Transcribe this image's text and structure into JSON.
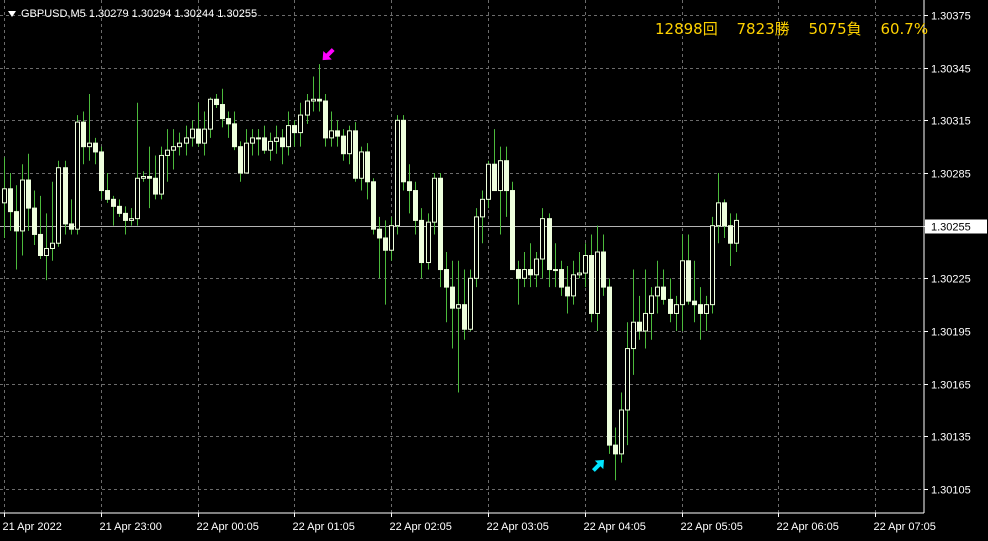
{
  "symbol_info": "GBPUSD,M5  1.30279 1.30294 1.30244 1.30255",
  "stats": {
    "total": "12898回",
    "wins": "7823勝",
    "losses": "5075負",
    "rate": "60.7%"
  },
  "colors": {
    "background": "#000000",
    "grid": "#6b6b6b",
    "candle_body": "#eeffdd",
    "wick": "#4cbb3c",
    "axis_text": "#ffffff",
    "price_line": "#b4b4b4",
    "sell_arrow": "#ff00ff",
    "buy_arrow": "#00e5ff",
    "stats_text": "#ffd200"
  },
  "chart_data": {
    "type": "candlestick",
    "symbol": "GBPUSD",
    "timeframe": "M5",
    "ylim": [
      1.30085,
      1.30385
    ],
    "y_ticks": [
      "1.30375",
      "1.30345",
      "1.30315",
      "1.30285",
      "1.30255",
      "1.30225",
      "1.30195",
      "1.30165",
      "1.30135",
      "1.30105"
    ],
    "current_price": "1.30255",
    "x_tick_labels": [
      "21 Apr 2022",
      "21 Apr 23:00",
      "22 Apr 00:05",
      "22 Apr 01:05",
      "22 Apr 02:05",
      "22 Apr 03:05",
      "22 Apr 04:05",
      "22 Apr 05:05",
      "22 Apr 06:05",
      "22 Apr 07:05"
    ],
    "x_tick_bars": [
      0,
      16,
      32,
      48,
      64,
      80,
      96,
      112,
      128,
      144
    ],
    "candles": [
      [
        1.30268,
        1.30294,
        1.30248,
        1.30276
      ],
      [
        1.30276,
        1.30285,
        1.30252,
        1.30263
      ],
      [
        1.30263,
        1.30278,
        1.3023,
        1.30252
      ],
      [
        1.30252,
        1.3029,
        1.30238,
        1.30281
      ],
      [
        1.30281,
        1.30296,
        1.30252,
        1.30265
      ],
      [
        1.30265,
        1.30275,
        1.30244,
        1.3025
      ],
      [
        1.3025,
        1.30272,
        1.30236,
        1.30238
      ],
      [
        1.30238,
        1.30262,
        1.30224,
        1.30242
      ],
      [
        1.30242,
        1.3028,
        1.30235,
        1.30245
      ],
      [
        1.30245,
        1.30292,
        1.30243,
        1.30288
      ],
      [
        1.30288,
        1.30292,
        1.3025,
        1.30256
      ],
      [
        1.30256,
        1.3027,
        1.3025,
        1.30253
      ],
      [
        1.30253,
        1.30318,
        1.3025,
        1.30314
      ],
      [
        1.30314,
        1.3032,
        1.3029,
        1.303
      ],
      [
        1.303,
        1.3033,
        1.30292,
        1.30302
      ],
      [
        1.30302,
        1.30305,
        1.3029,
        1.30297
      ],
      [
        1.30297,
        1.303,
        1.3027,
        1.30275
      ],
      [
        1.30275,
        1.30285,
        1.30268,
        1.3027
      ],
      [
        1.3027,
        1.30272,
        1.30255,
        1.30266
      ],
      [
        1.30266,
        1.3027,
        1.3026,
        1.30262
      ],
      [
        1.30262,
        1.30266,
        1.3025,
        1.30258
      ],
      [
        1.30258,
        1.30265,
        1.30255,
        1.30259
      ],
      [
        1.30259,
        1.30325,
        1.30255,
        1.30282
      ],
      [
        1.30282,
        1.30286,
        1.3028,
        1.30283
      ],
      [
        1.30283,
        1.303,
        1.30265,
        1.30282
      ],
      [
        1.30282,
        1.30295,
        1.3027,
        1.30273
      ],
      [
        1.30273,
        1.303,
        1.3027,
        1.30295
      ],
      [
        1.30295,
        1.3031,
        1.3028,
        1.30298
      ],
      [
        1.30298,
        1.3031,
        1.30287,
        1.303
      ],
      [
        1.303,
        1.30308,
        1.30295,
        1.30302
      ],
      [
        1.30302,
        1.30312,
        1.30295,
        1.30305
      ],
      [
        1.30305,
        1.30315,
        1.303,
        1.3031
      ],
      [
        1.3031,
        1.30325,
        1.303,
        1.30302
      ],
      [
        1.30302,
        1.3032,
        1.30295,
        1.3031
      ],
      [
        1.3031,
        1.30328,
        1.30305,
        1.30327
      ],
      [
        1.30327,
        1.3033,
        1.30322,
        1.30324
      ],
      [
        1.30324,
        1.30333,
        1.30311,
        1.30316
      ],
      [
        1.30316,
        1.3032,
        1.30305,
        1.30313
      ],
      [
        1.30313,
        1.3032,
        1.30298,
        1.303
      ],
      [
        1.303,
        1.30303,
        1.3028,
        1.30285
      ],
      [
        1.30285,
        1.3031,
        1.30285,
        1.30302
      ],
      [
        1.30302,
        1.3031,
        1.30295,
        1.30305
      ],
      [
        1.30305,
        1.3031,
        1.30295,
        1.30305
      ],
      [
        1.30305,
        1.30312,
        1.30296,
        1.30298
      ],
      [
        1.30298,
        1.30308,
        1.30292,
        1.30303
      ],
      [
        1.30303,
        1.30312,
        1.30296,
        1.30305
      ],
      [
        1.30305,
        1.3031,
        1.3029,
        1.303
      ],
      [
        1.303,
        1.3032,
        1.30295,
        1.30312
      ],
      [
        1.30312,
        1.30315,
        1.303,
        1.30308
      ],
      [
        1.30308,
        1.30325,
        1.303,
        1.30318
      ],
      [
        1.30318,
        1.3033,
        1.30313,
        1.30326
      ],
      [
        1.30326,
        1.3034,
        1.3032,
        1.30327
      ],
      [
        1.30327,
        1.30347,
        1.3032,
        1.30326
      ],
      [
        1.30326,
        1.3033,
        1.303,
        1.30305
      ],
      [
        1.30305,
        1.3032,
        1.303,
        1.30309
      ],
      [
        1.30309,
        1.30315,
        1.303,
        1.30306
      ],
      [
        1.30306,
        1.3031,
        1.30292,
        1.30296
      ],
      [
        1.30296,
        1.30312,
        1.3029,
        1.30309
      ],
      [
        1.30309,
        1.30314,
        1.3028,
        1.30282
      ],
      [
        1.30282,
        1.303,
        1.30275,
        1.30297
      ],
      [
        1.30297,
        1.30302,
        1.3027,
        1.3028
      ],
      [
        1.3028,
        1.30282,
        1.3025,
        1.30253
      ],
      [
        1.30253,
        1.3026,
        1.30225,
        1.30248
      ],
      [
        1.30248,
        1.30258,
        1.3021,
        1.30241
      ],
      [
        1.30241,
        1.3026,
        1.30235,
        1.30255
      ],
      [
        1.30255,
        1.30318,
        1.3025,
        1.30315
      ],
      [
        1.30315,
        1.30318,
        1.30275,
        1.3028
      ],
      [
        1.3028,
        1.3029,
        1.30262,
        1.30275
      ],
      [
        1.30275,
        1.3028,
        1.3025,
        1.30258
      ],
      [
        1.30258,
        1.30265,
        1.30225,
        1.30234
      ],
      [
        1.30234,
        1.30262,
        1.3023,
        1.30257
      ],
      [
        1.30257,
        1.30285,
        1.3025,
        1.30282
      ],
      [
        1.30282,
        1.30285,
        1.3022,
        1.3023
      ],
      [
        1.3023,
        1.3024,
        1.302,
        1.3022
      ],
      [
        1.3022,
        1.30235,
        1.30185,
        1.30208
      ],
      [
        1.30208,
        1.30235,
        1.3016,
        1.3021
      ],
      [
        1.3021,
        1.3023,
        1.3019,
        1.30196
      ],
      [
        1.30196,
        1.3023,
        1.30195,
        1.30225
      ],
      [
        1.30225,
        1.30265,
        1.3022,
        1.3026
      ],
      [
        1.3026,
        1.30275,
        1.30245,
        1.3027
      ],
      [
        1.3027,
        1.30292,
        1.30265,
        1.3029
      ],
      [
        1.3029,
        1.3031,
        1.3028,
        1.30275
      ],
      [
        1.30275,
        1.303,
        1.3025,
        1.30292
      ],
      [
        1.30292,
        1.303,
        1.3026,
        1.30275
      ],
      [
        1.30275,
        1.3028,
        1.3023,
        1.3023
      ],
      [
        1.3023,
        1.30235,
        1.3021,
        1.30225
      ],
      [
        1.30225,
        1.3024,
        1.3022,
        1.3023
      ],
      [
        1.3023,
        1.30245,
        1.3022,
        1.30227
      ],
      [
        1.30227,
        1.3024,
        1.3022,
        1.30236
      ],
      [
        1.30236,
        1.30265,
        1.30225,
        1.30259
      ],
      [
        1.30259,
        1.30262,
        1.3022,
        1.3023
      ],
      [
        1.3023,
        1.30245,
        1.3022,
        1.3023
      ],
      [
        1.3023,
        1.30235,
        1.30215,
        1.3022
      ],
      [
        1.3022,
        1.30232,
        1.30205,
        1.30215
      ],
      [
        1.30215,
        1.30235,
        1.3021,
        1.30227
      ],
      [
        1.30227,
        1.3024,
        1.30225,
        1.30228
      ],
      [
        1.30228,
        1.30245,
        1.3022,
        1.30238
      ],
      [
        1.30238,
        1.3025,
        1.302,
        1.30205
      ],
      [
        1.30205,
        1.30255,
        1.30195,
        1.3024
      ],
      [
        1.3024,
        1.3025,
        1.30215,
        1.3022
      ],
      [
        1.3022,
        1.30225,
        1.30125,
        1.3013
      ],
      [
        1.3013,
        1.3014,
        1.3011,
        1.30125
      ],
      [
        1.30125,
        1.3016,
        1.3012,
        1.3015
      ],
      [
        1.3015,
        1.302,
        1.3013,
        1.30185
      ],
      [
        1.30185,
        1.3023,
        1.3017,
        1.302
      ],
      [
        1.302,
        1.30215,
        1.3019,
        1.30195
      ],
      [
        1.30195,
        1.3023,
        1.30185,
        1.30205
      ],
      [
        1.30205,
        1.3022,
        1.3019,
        1.30215
      ],
      [
        1.30215,
        1.30235,
        1.30205,
        1.3022
      ],
      [
        1.3022,
        1.3023,
        1.3021,
        1.30213
      ],
      [
        1.30213,
        1.30225,
        1.302,
        1.30205
      ],
      [
        1.30205,
        1.30215,
        1.30195,
        1.3021
      ],
      [
        1.3021,
        1.3025,
        1.30195,
        1.30235
      ],
      [
        1.30235,
        1.3025,
        1.3021,
        1.30212
      ],
      [
        1.30212,
        1.30235,
        1.302,
        1.3021
      ],
      [
        1.3021,
        1.3022,
        1.3019,
        1.30205
      ],
      [
        1.30205,
        1.30215,
        1.30195,
        1.3021
      ],
      [
        1.3021,
        1.3026,
        1.30205,
        1.30255
      ],
      [
        1.30255,
        1.30285,
        1.30245,
        1.30268
      ],
      [
        1.30268,
        1.3027,
        1.30248,
        1.30255
      ],
      [
        1.30255,
        1.30262,
        1.30232,
        1.30245
      ],
      [
        1.30245,
        1.30262,
        1.3024,
        1.30258
      ]
    ],
    "signals": [
      {
        "type": "sell",
        "bar": 52
      },
      {
        "type": "buy",
        "bar": 100
      }
    ]
  }
}
